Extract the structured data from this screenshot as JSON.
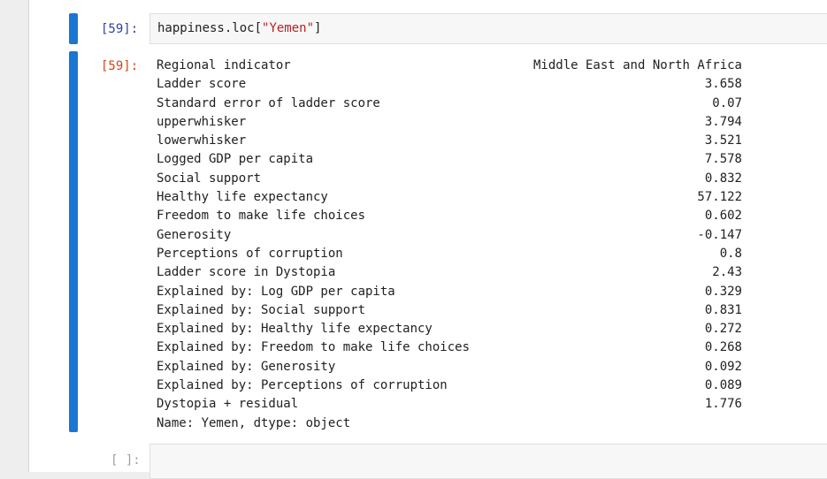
{
  "input_cell": {
    "prompt": "[59]:",
    "code_prefix": "happiness.loc[",
    "code_string": "\"Yemen\"",
    "code_suffix": "]"
  },
  "output_cell": {
    "prompt": "[59]:",
    "rows": [
      {
        "key": "Regional indicator",
        "value": "Middle East and North Africa"
      },
      {
        "key": "Ladder score",
        "value": "3.658"
      },
      {
        "key": "Standard error of ladder score",
        "value": "0.07"
      },
      {
        "key": "upperwhisker",
        "value": "3.794"
      },
      {
        "key": "lowerwhisker",
        "value": "3.521"
      },
      {
        "key": "Logged GDP per capita",
        "value": "7.578"
      },
      {
        "key": "Social support",
        "value": "0.832"
      },
      {
        "key": "Healthy life expectancy",
        "value": "57.122"
      },
      {
        "key": "Freedom to make life choices",
        "value": "0.602"
      },
      {
        "key": "Generosity",
        "value": "-0.147"
      },
      {
        "key": "Perceptions of corruption",
        "value": "0.8"
      },
      {
        "key": "Ladder score in Dystopia",
        "value": "2.43"
      },
      {
        "key": "Explained by: Log GDP per capita",
        "value": "0.329"
      },
      {
        "key": "Explained by: Social support",
        "value": "0.831"
      },
      {
        "key": "Explained by: Healthy life expectancy",
        "value": "0.272"
      },
      {
        "key": "Explained by: Freedom to make life choices",
        "value": "0.268"
      },
      {
        "key": "Explained by: Generosity",
        "value": "0.092"
      },
      {
        "key": "Explained by: Perceptions of corruption",
        "value": "0.089"
      },
      {
        "key": "Dystopia + residual",
        "value": "1.776"
      }
    ],
    "footer": "Name: Yemen, dtype: object"
  },
  "empty_cell": {
    "prompt": "[ ]:"
  },
  "colors": {
    "active_bar": "#1976d2",
    "input_prompt": "#303f9f",
    "output_prompt": "#d84315",
    "string_literal": "#ba2121"
  }
}
